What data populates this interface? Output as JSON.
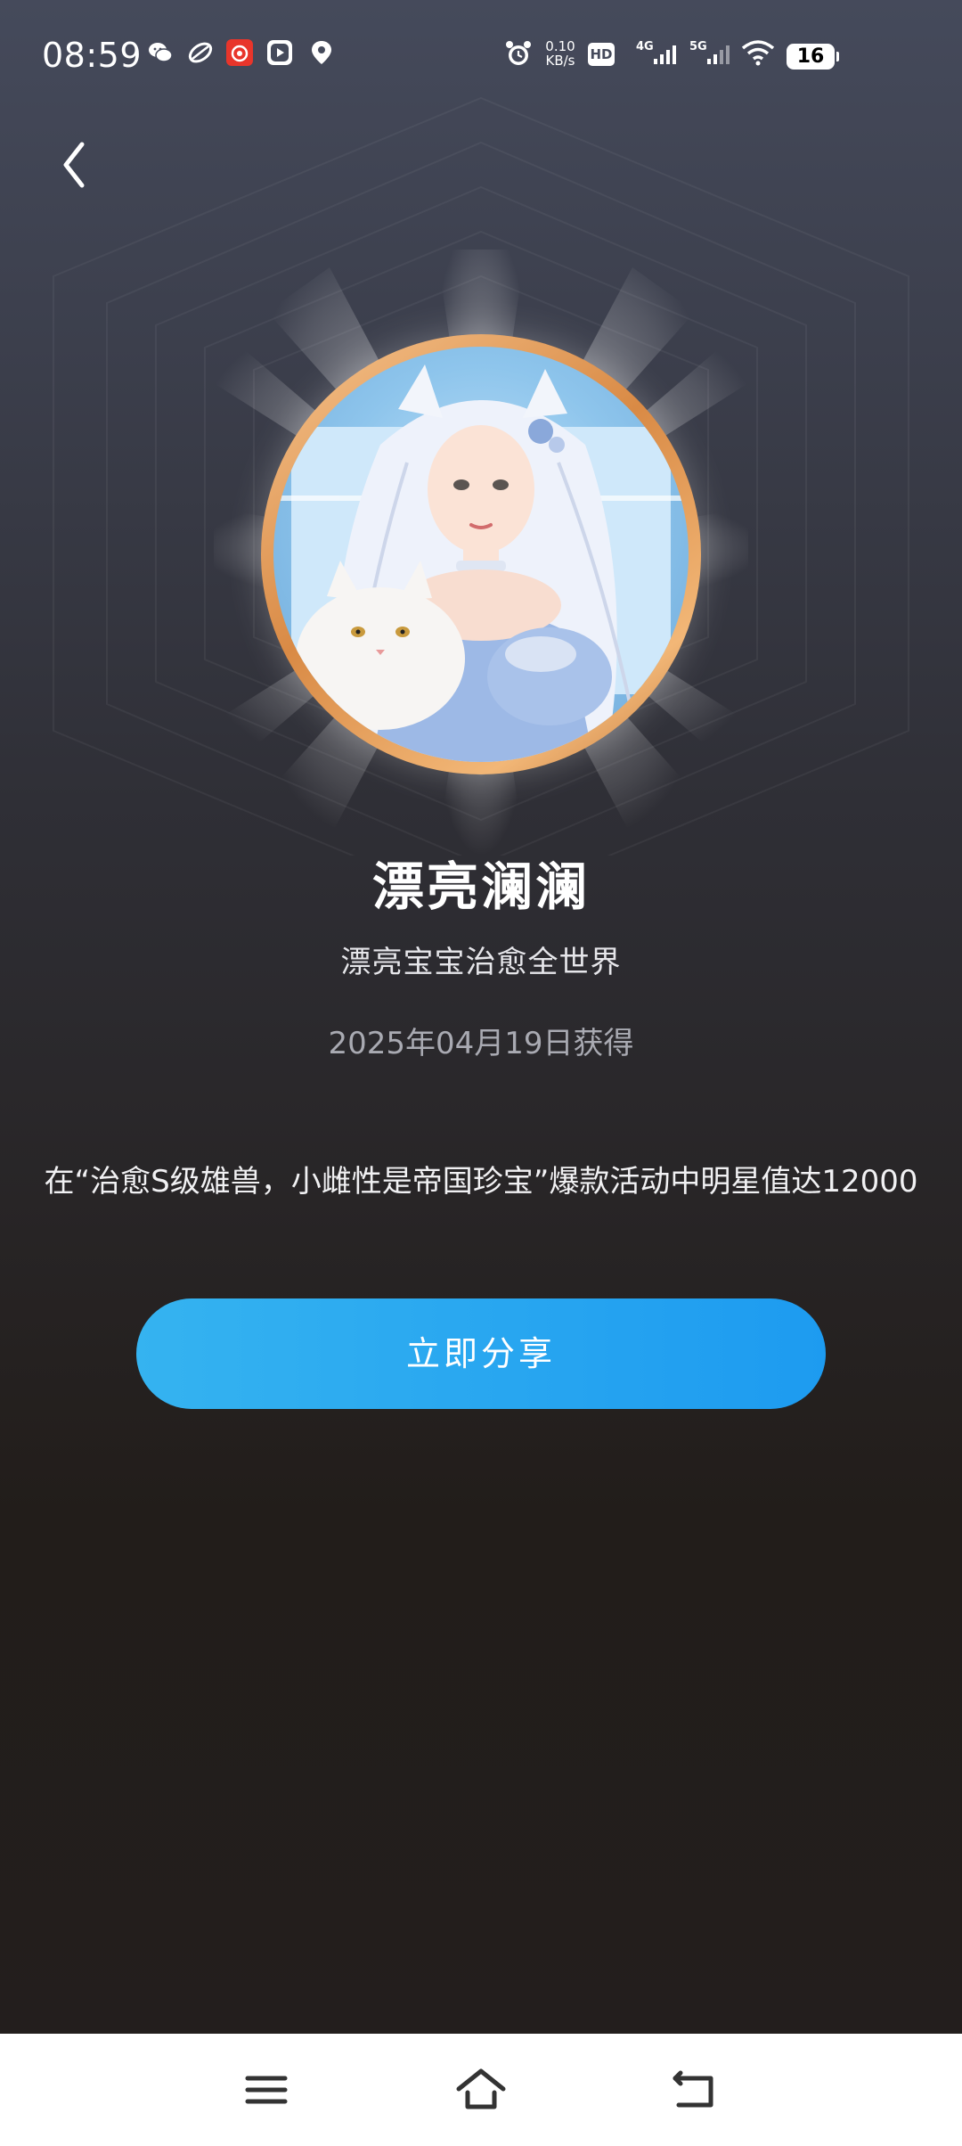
{
  "status_bar": {
    "time": "08:59",
    "net_speed_value": "0.10",
    "net_speed_unit": "KB/s",
    "hd_label": "HD",
    "sim_4g": "4G",
    "sim_5g": "5G",
    "battery_level": "16",
    "notification_icons": [
      "wechat-icon",
      "leaf-app-icon",
      "red-app-icon",
      "video-app-icon",
      "location-pin-icon"
    ],
    "system_icons": [
      "alarm-icon",
      "hd-icon",
      "signal-4g-icon",
      "signal-5g-icon",
      "wifi-icon",
      "battery-icon"
    ]
  },
  "header": {
    "back_icon": "chevron-left-icon"
  },
  "badge": {
    "title": "漂亮澜澜",
    "subtitle": "漂亮宝宝治愈全世界",
    "obtained_date": "2025年04月19日获得",
    "description": "在“治愈S级雄兽，小雌性是帝国珍宝”爆款活动中明星值达12000",
    "image": "avatar-girl-with-white-cat",
    "ring_color": "#e0944f"
  },
  "actions": {
    "share_label": "立即分享",
    "share_color": "#1d9bf0"
  },
  "nav_bar": {
    "items": [
      "menu-icon",
      "home-icon",
      "back-icon"
    ]
  }
}
